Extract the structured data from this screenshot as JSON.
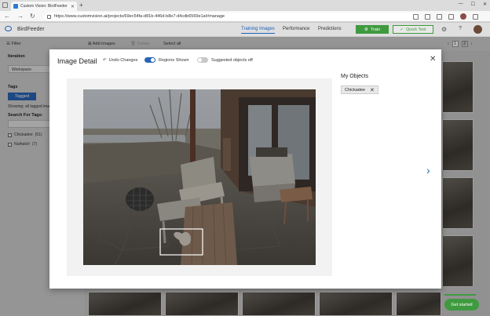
{
  "browser": {
    "tab_title": "Custom Vision: BirdFeeder - Tra",
    "new_tab": "+",
    "url": "https://www.customvision.ai/projects/69ec54fa-d81b-446d-b8e7-d4cdb6569e1a#/manage"
  },
  "header": {
    "app_name": "BirdFeeder",
    "tabs": [
      {
        "label": "Training Images",
        "active": true
      },
      {
        "label": "Performance",
        "active": false
      },
      {
        "label": "Predictions",
        "active": false
      }
    ],
    "train_label": "Train",
    "quick_test_label": "Quick Test",
    "help": "?"
  },
  "left_panel": {
    "filter": "Filter",
    "iteration_label": "Iteration",
    "iteration_value": "Workspace",
    "tags_label": "Tags",
    "tagged_label": "Tagged",
    "showing": "Showing: all tagged ima",
    "search_label": "Search For Tags:",
    "tags": [
      {
        "name": "Chickadee",
        "count": "(51)"
      },
      {
        "name": "Nuthatch",
        "count": "(7)"
      }
    ]
  },
  "toolbar": {
    "add_images": "Add images",
    "delete": "Delete",
    "select_all": "Select all"
  },
  "pager": {
    "prev": "‹",
    "pages": [
      "1",
      "2"
    ],
    "next": "›"
  },
  "get_started": "Get started",
  "modal": {
    "title": "Image Detail",
    "undo": "Undo Changes",
    "regions_shown": "Regions Shown",
    "suggested_off": "Suggested objects off",
    "my_objects": "My Objects",
    "objects": [
      {
        "label": "Chickadee"
      }
    ]
  },
  "colors": {
    "accent": "#2a65b3",
    "train": "#3f9a3f"
  }
}
